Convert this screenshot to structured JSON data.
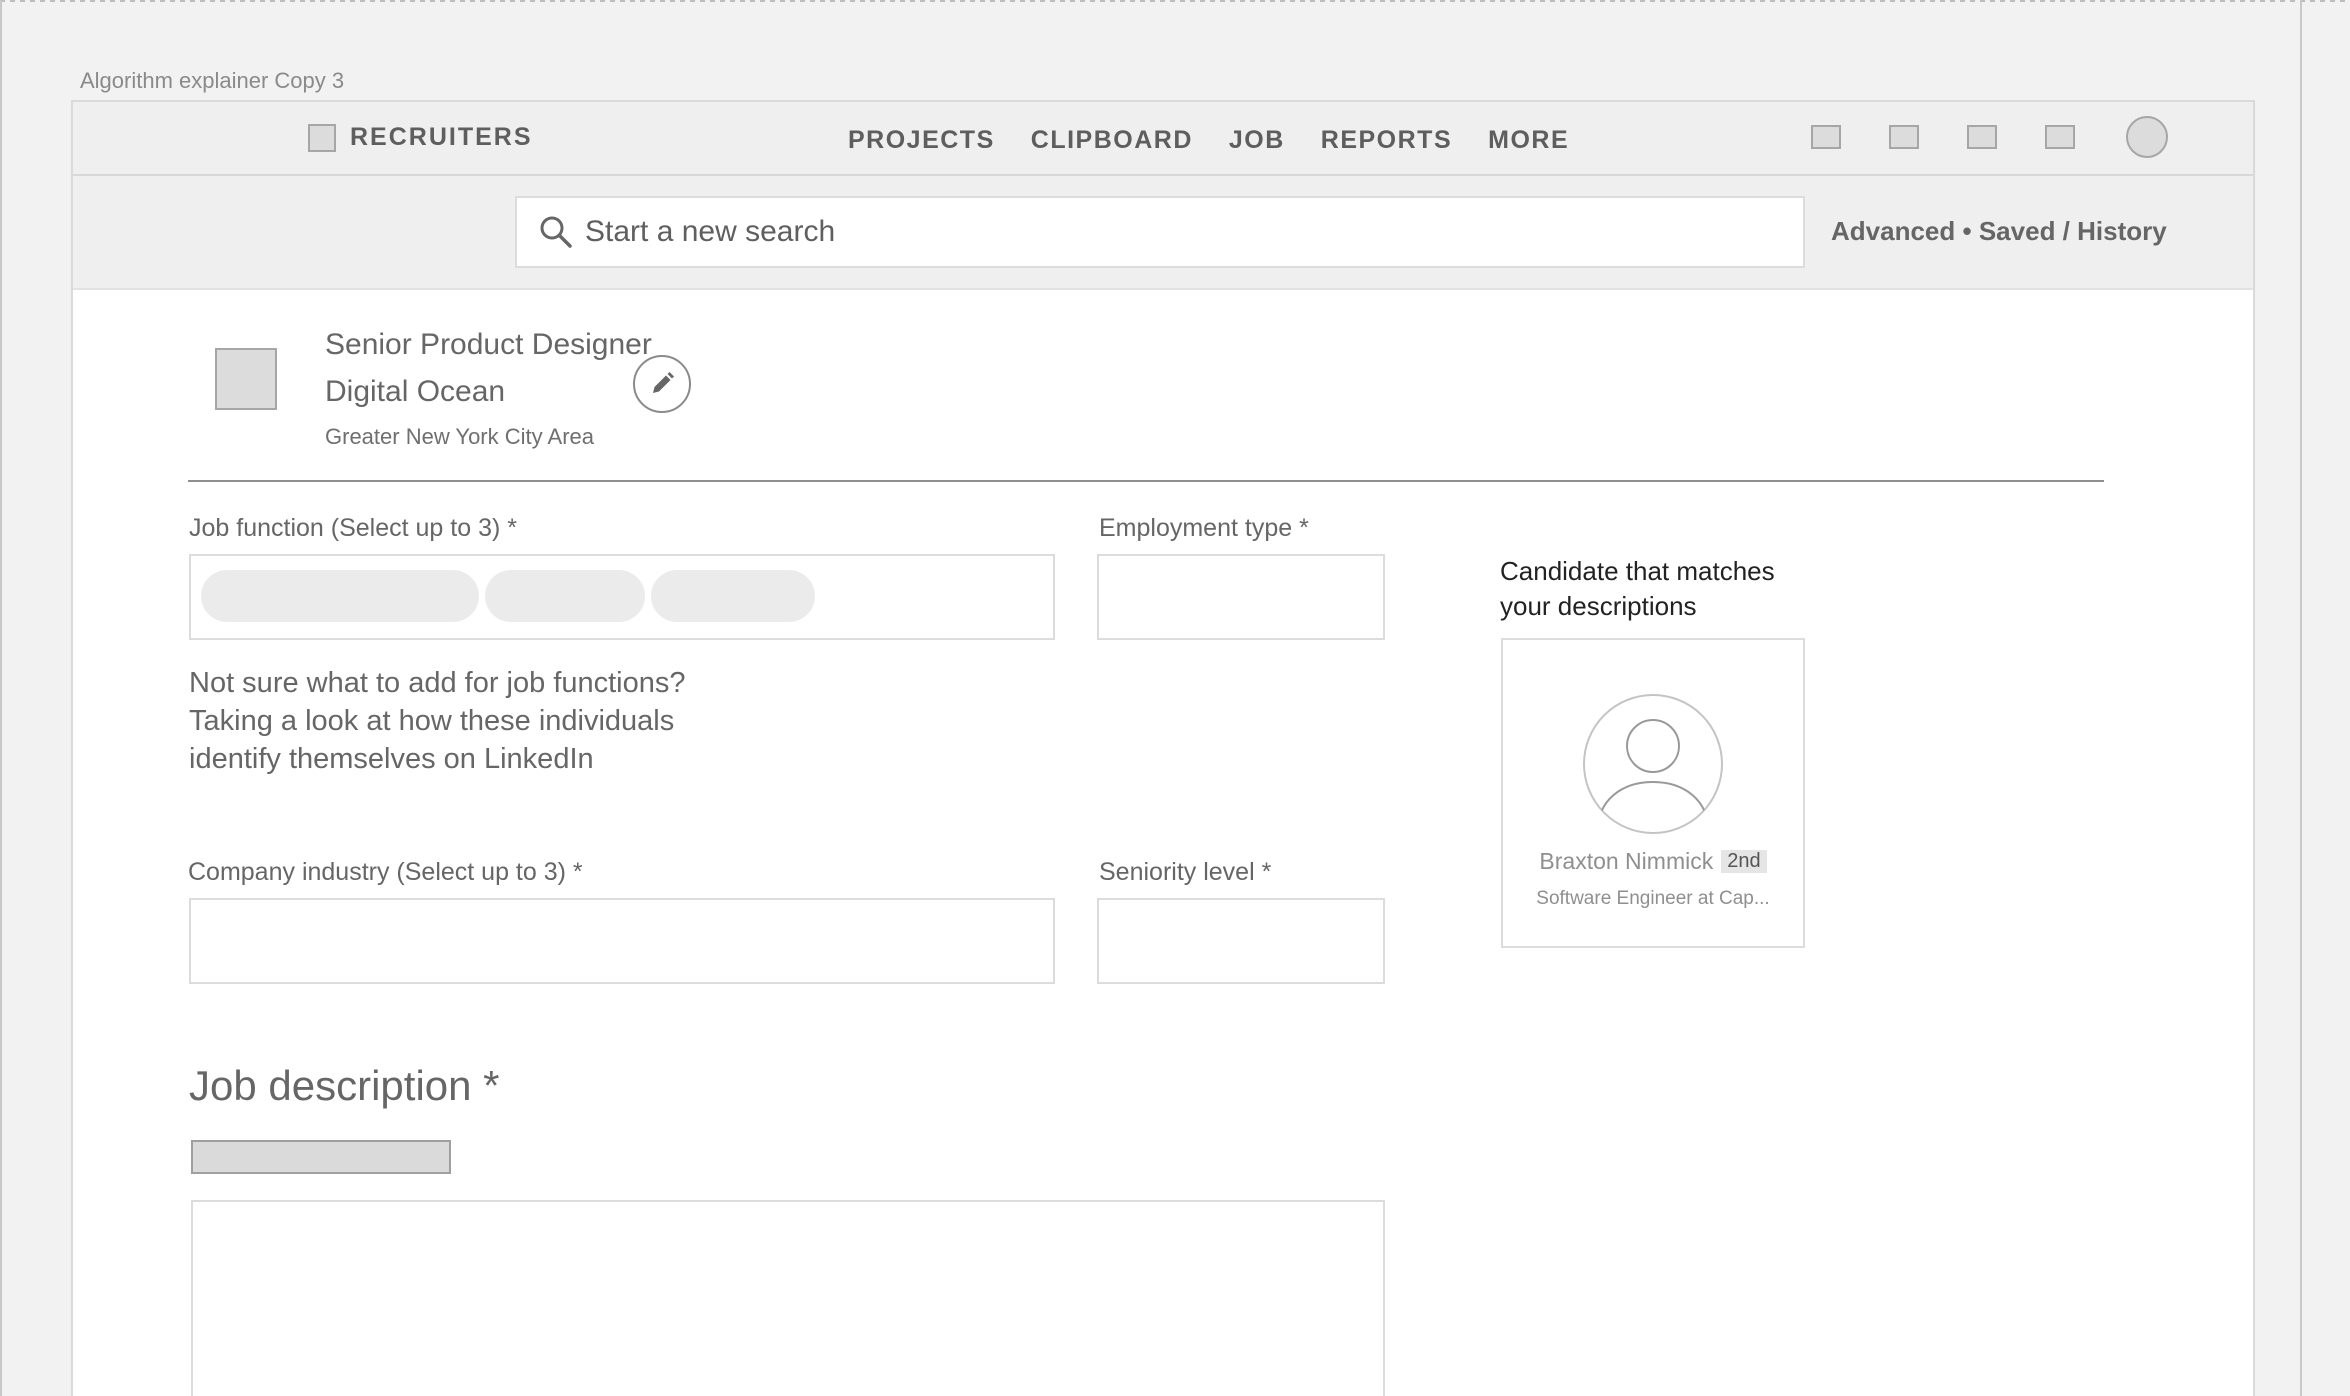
{
  "artboard": {
    "label": "Algorithm explainer Copy 3"
  },
  "topnav": {
    "brand": "RECRUITERS",
    "links": [
      "PROJECTS",
      "CLIPBOARD",
      "JOB",
      "REPORTS",
      "MORE"
    ]
  },
  "search": {
    "placeholder": "Start a new search",
    "links": {
      "advanced": "Advanced",
      "separator": "•",
      "saved_history": "Saved / History"
    }
  },
  "job": {
    "title": "Senior Product Designer",
    "company": "Digital Ocean",
    "location": "Greater New York City Area"
  },
  "form": {
    "job_function_label": "Job function (Select up to 3) *",
    "employment_type_label": "Employment type *",
    "helper_lines": [
      "Not sure what to add for job functions?",
      "Taking a look at how these individuals",
      "identify themselves on LinkedIn"
    ],
    "company_industry_label": "Company industry (Select up to 3) *",
    "seniority_label": "Seniority level *",
    "job_description_label": "Job description *"
  },
  "candidate": {
    "heading_lines": [
      "Candidate that matches",
      "your descriptions"
    ],
    "name": "Braxton Nimmick",
    "degree": "2nd",
    "headline": "Software Engineer at Cap..."
  },
  "colors": {
    "nav_bg": "#efefef",
    "placeholder_fill": "#dcdcdc",
    "placeholder_stroke": "#a6a6a6",
    "text": "#666666"
  }
}
